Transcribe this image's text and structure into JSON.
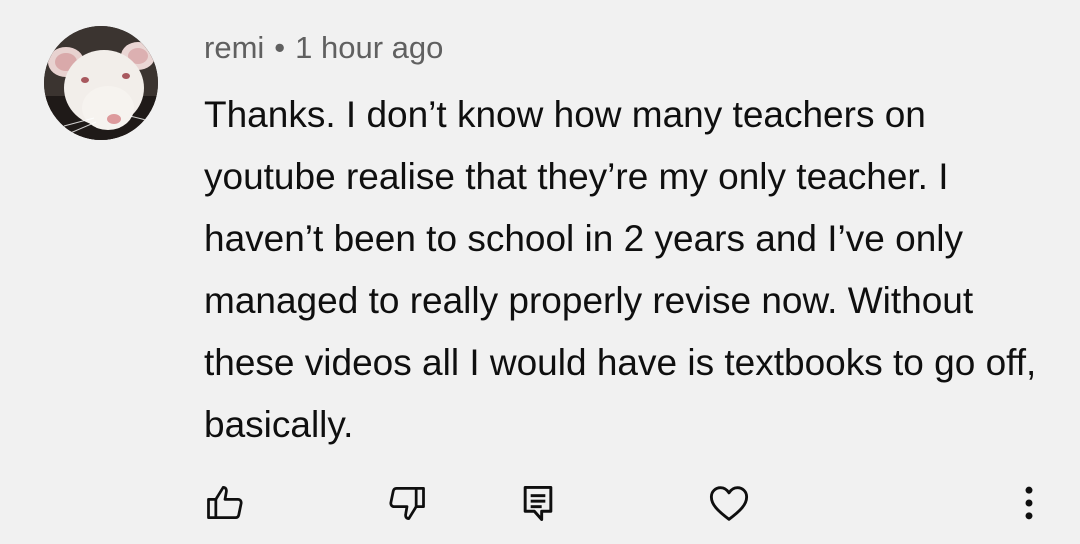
{
  "comment": {
    "author": "remi",
    "separator": "•",
    "timestamp": "1 hour ago",
    "text": "Thanks. I don’t know how many teachers on youtube realise that they’re my only teacher. I haven’t been to school in 2 years and I’ve only managed to really properly revise now. Without these videos all I would have is textbooks to go off, basically."
  },
  "actions": {
    "icons": [
      "thumbs-up-icon",
      "thumbs-down-icon",
      "reply-icon",
      "heart-icon",
      "more-vert-icon"
    ]
  },
  "colors": {
    "background": "#f1f1f1",
    "text": "#0f0f0f",
    "meta": "#606060"
  }
}
